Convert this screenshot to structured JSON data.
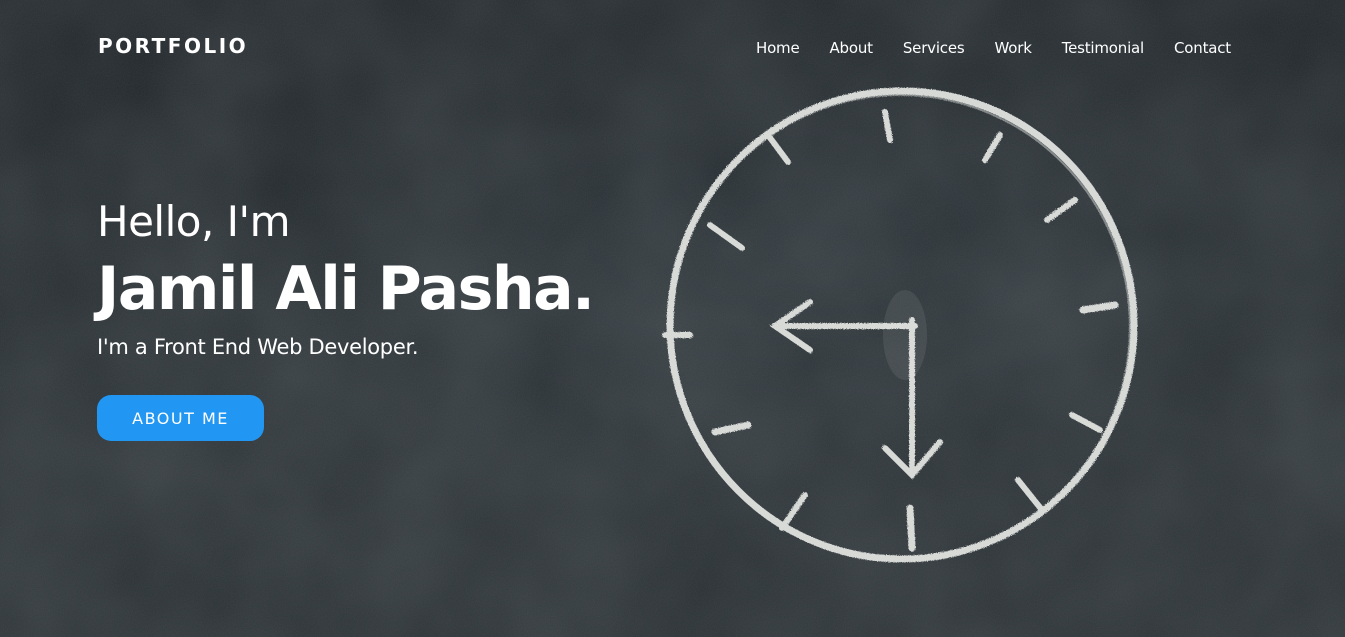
{
  "nav": {
    "logo": "PORTFOLIO",
    "items": [
      "Home",
      "About",
      "Services",
      "Work",
      "Testimonial",
      "Contact"
    ]
  },
  "hero": {
    "greeting": "Hello, I'm",
    "name": "Jamil Ali Pasha.",
    "role": "I'm a Front End Web Developer.",
    "cta_label": "ABOUT ME"
  },
  "colors": {
    "background": "#1e2428",
    "accent": "#2196f3",
    "text": "#ffffff",
    "chalk": "#e4e6e2"
  },
  "icons": {
    "clock": "chalk-clock-illustration"
  }
}
